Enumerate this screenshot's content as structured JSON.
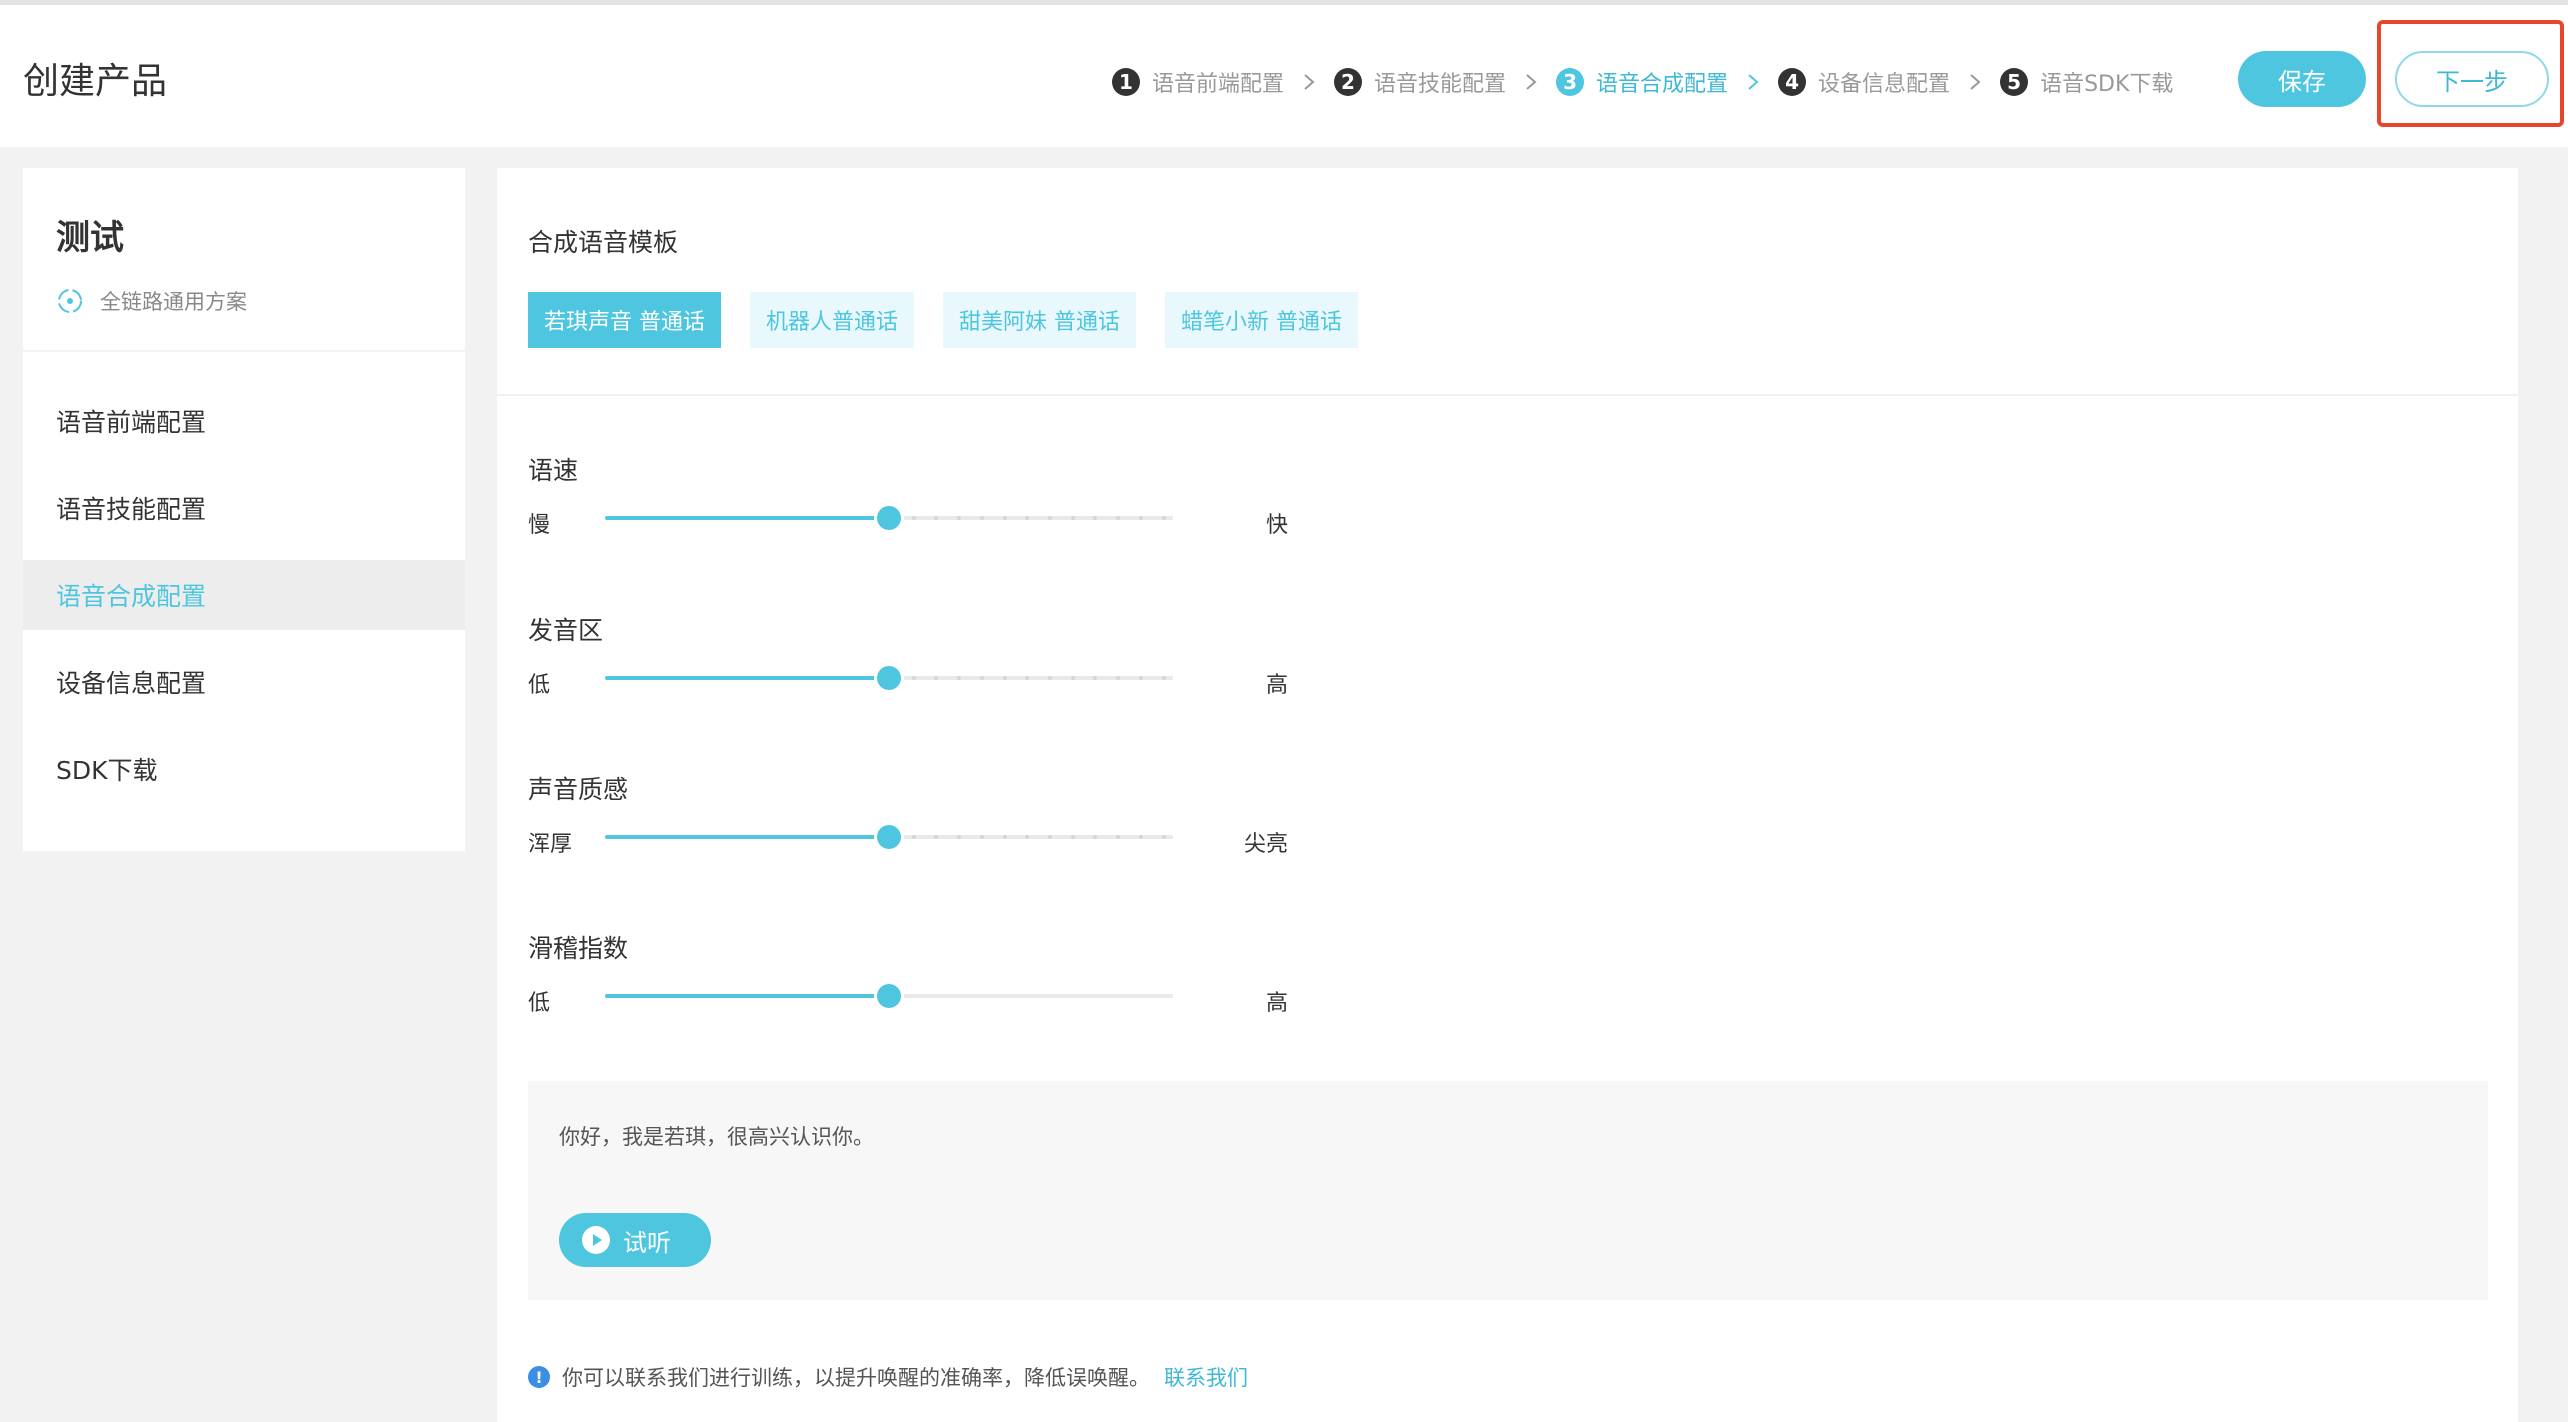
{
  "header": {
    "title": "创建产品",
    "steps": [
      {
        "num": "1",
        "label": "语音前端配置"
      },
      {
        "num": "2",
        "label": "语音技能配置"
      },
      {
        "num": "3",
        "label": "语音合成配置"
      },
      {
        "num": "4",
        "label": "设备信息配置"
      },
      {
        "num": "5",
        "label": "语音SDK下载"
      }
    ],
    "active_step": 3,
    "save_label": "保存",
    "next_label": "下一步"
  },
  "sidebar": {
    "title": "测试",
    "subtitle": "全链路通用方案",
    "items": [
      {
        "label": "语音前端配置"
      },
      {
        "label": "语音技能配置"
      },
      {
        "label": "语音合成配置"
      },
      {
        "label": "设备信息配置"
      },
      {
        "label": "SDK下载"
      }
    ],
    "active_index": 2
  },
  "main": {
    "template_title": "合成语音模板",
    "templates": [
      {
        "label": "若琪声音 普通话"
      },
      {
        "label": "机器人普通话"
      },
      {
        "label": "甜美阿妹 普通话"
      },
      {
        "label": "蜡笔小新 普通话"
      }
    ],
    "active_template": 0,
    "params": [
      {
        "title": "语速",
        "low": "慢",
        "high": "快",
        "value": 0.5
      },
      {
        "title": "发音区",
        "low": "低",
        "high": "高",
        "value": 0.5
      },
      {
        "title": "声音质感",
        "low": "浑厚",
        "high": "尖亮",
        "value": 0.5
      },
      {
        "title": "滑稽指数",
        "low": "低",
        "high": "高",
        "value": 0.5
      }
    ],
    "preview_text": "你好，我是若琪，很高兴认识你。",
    "play_label": "试听",
    "notice_text": "你可以联系我们进行训练，以提升唤醒的准确率，降低误唤醒。",
    "notice_link": "联系我们"
  },
  "colors": {
    "accent": "#4ec6e0",
    "highlight": "#e8462b"
  }
}
